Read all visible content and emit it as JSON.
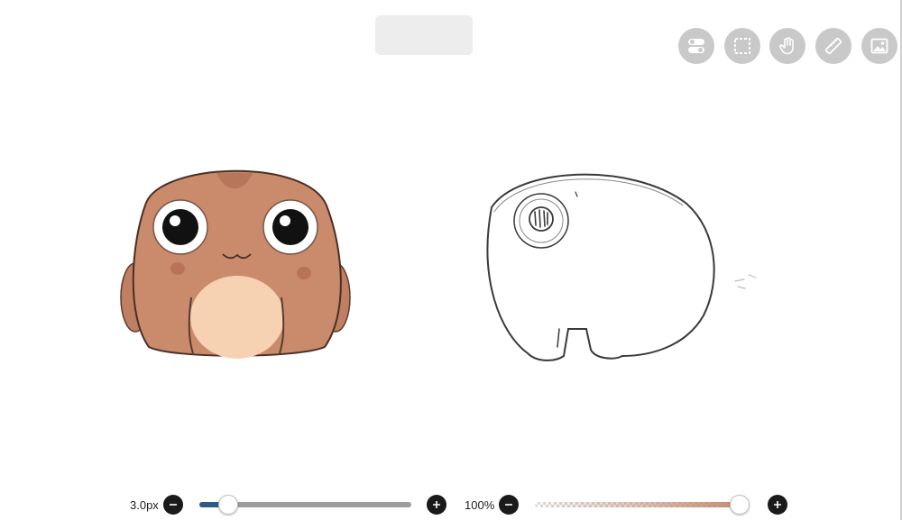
{
  "toolbar": {
    "tools": [
      {
        "name": "layers-toggle-icon"
      },
      {
        "name": "selection-icon"
      },
      {
        "name": "hand-icon"
      },
      {
        "name": "ruler-icon"
      },
      {
        "name": "image-icon"
      }
    ],
    "button_color": "#c9c9c9"
  },
  "brush_size": {
    "label": "3.0px",
    "level_fraction": 0.1,
    "fill_color": "#2b5b86"
  },
  "brush_opacity": {
    "label": "100%",
    "level_fraction": 1.0,
    "color": "#c2876d"
  },
  "canvas": {
    "subjects": [
      "toad-painting",
      "toad-sketch"
    ],
    "toad_colors": {
      "body": "#c98b6c",
      "belly": "#f6d2b3",
      "outline": "#4a2f25"
    }
  }
}
